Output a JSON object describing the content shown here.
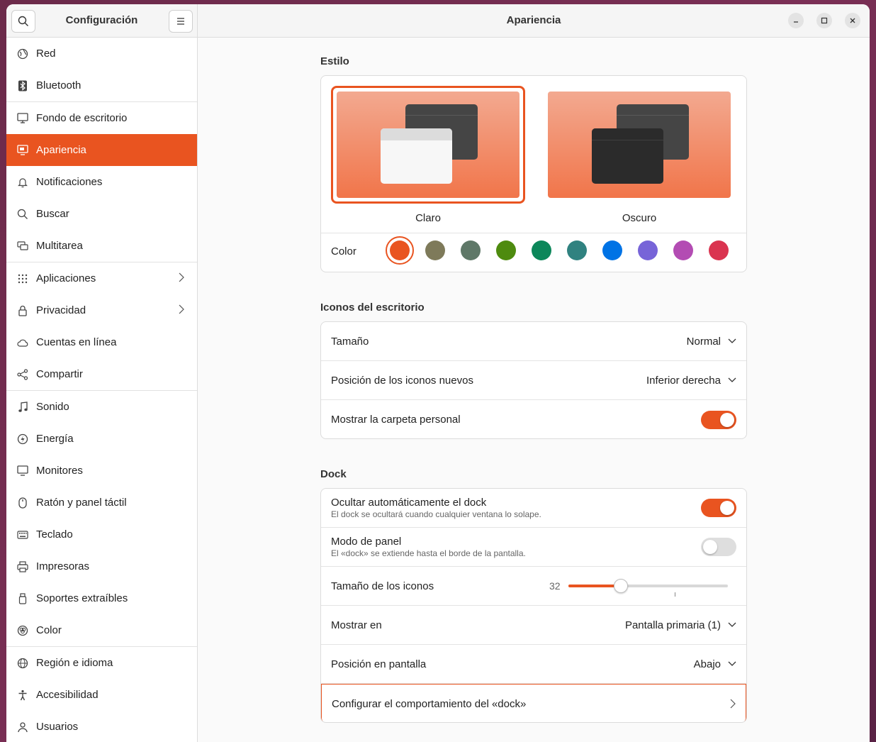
{
  "sidebar": {
    "title": "Configuración",
    "items": [
      {
        "label": "Red",
        "icon": "globe-icon"
      },
      {
        "label": "Bluetooth",
        "icon": "bluetooth-icon"
      },
      {
        "label": "Fondo de escritorio",
        "icon": "desktop-icon"
      },
      {
        "label": "Apariencia",
        "icon": "appearance-icon",
        "active": true
      },
      {
        "label": "Notificaciones",
        "icon": "bell-icon"
      },
      {
        "label": "Buscar",
        "icon": "search-icon"
      },
      {
        "label": "Multitarea",
        "icon": "multitask-icon"
      },
      {
        "label": "Aplicaciones",
        "icon": "apps-grid-icon"
      },
      {
        "label": "Privacidad",
        "icon": "lock-icon"
      },
      {
        "label": "Cuentas en línea",
        "icon": "cloud-icon"
      },
      {
        "label": "Compartir",
        "icon": "share-icon"
      },
      {
        "label": "Sonido",
        "icon": "music-note-icon"
      },
      {
        "label": "Energía",
        "icon": "power-icon"
      },
      {
        "label": "Monitores",
        "icon": "monitor-icon"
      },
      {
        "label": "Ratón y panel táctil",
        "icon": "mouse-icon"
      },
      {
        "label": "Teclado",
        "icon": "keyboard-icon"
      },
      {
        "label": "Impresoras",
        "icon": "printer-icon"
      },
      {
        "label": "Soportes extraíbles",
        "icon": "usb-drive-icon"
      },
      {
        "label": "Color",
        "icon": "color-icon"
      },
      {
        "label": "Región e idioma",
        "icon": "region-globe-icon"
      },
      {
        "label": "Accesibilidad",
        "icon": "accessibility-icon"
      },
      {
        "label": "Usuarios",
        "icon": "user-icon"
      }
    ]
  },
  "header": {
    "title": "Apariencia"
  },
  "style": {
    "section_title": "Estilo",
    "light_label": "Claro",
    "dark_label": "Oscuro",
    "selected": "light",
    "color_label": "Color",
    "colors": [
      "#e95420",
      "#7e7a5a",
      "#5f7868",
      "#4e8b0f",
      "#0c875a",
      "#308280",
      "#0073e5",
      "#7764d8",
      "#b34cb3",
      "#da3450"
    ],
    "selected_color": "#e95420"
  },
  "desktop_icons": {
    "section_title": "Iconos del escritorio",
    "size_label": "Tamaño",
    "size_value": "Normal",
    "position_label": "Posición de los iconos nuevos",
    "position_value": "Inferior derecha",
    "show_home_label": "Mostrar la carpeta personal",
    "show_home_on": true
  },
  "dock": {
    "section_title": "Dock",
    "autohide_label": "Ocultar automáticamente el dock",
    "autohide_sub": "El dock se ocultará cuando cualquier ventana lo solape.",
    "autohide_on": true,
    "panel_label": "Modo de panel",
    "panel_sub": "El «dock» se extiende hasta el borde de la pantalla.",
    "panel_on": false,
    "icon_size_label": "Tamaño de los iconos",
    "icon_size_value": "32",
    "icon_size_fraction": 0.33,
    "show_on_label": "Mostrar en",
    "show_on_value": "Pantalla primaria (1)",
    "position_label": "Posición en pantalla",
    "position_value": "Abajo",
    "configure_label": "Configurar el comportamiento del «dock»"
  },
  "colors": {
    "accent": "#e95420"
  }
}
